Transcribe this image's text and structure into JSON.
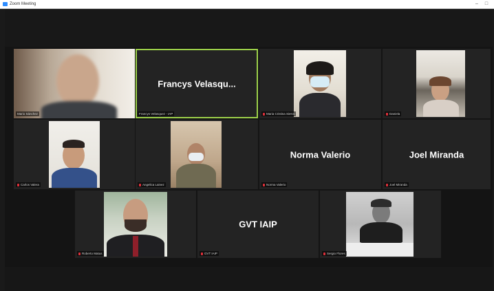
{
  "window": {
    "title": "Zoom Meeting",
    "controls": [
      "–",
      "□"
    ]
  },
  "participants": [
    {
      "name": "Mario Sánchez",
      "display": "",
      "muted": false
    },
    {
      "name": "Francys Velasquez - IAP",
      "display": "Francys  Velasqu...",
      "muted": false,
      "active": true
    },
    {
      "name": "Maria Cristina Sierra",
      "display": "",
      "muted": true
    },
    {
      "name": "Daniela",
      "display": "",
      "muted": true
    },
    {
      "name": "Carlos Valera",
      "display": "",
      "muted": true
    },
    {
      "name": "Angelica Lainez",
      "display": "",
      "muted": true
    },
    {
      "name": "Norma Valerio",
      "display": "Norma Valerio",
      "muted": true
    },
    {
      "name": "Joel Miranda",
      "display": "Joel Miranda",
      "muted": true
    },
    {
      "name": "Roberto Matus",
      "display": "",
      "muted": true
    },
    {
      "name": "GVT IAIP",
      "display": "GVT IAIP",
      "muted": true
    },
    {
      "name": "Sergio Flores",
      "display": "",
      "muted": true
    }
  ],
  "colors": {
    "active_speaker_border": "#9dd14a",
    "muted_icon": "#e0303a",
    "tile_bg": "#232323"
  }
}
